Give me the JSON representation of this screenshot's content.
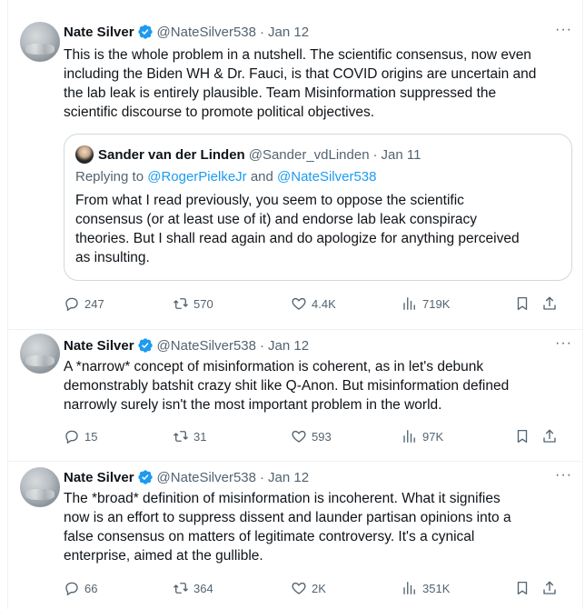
{
  "colors": {
    "text": "#0f1419",
    "secondary": "#536471",
    "link": "#1d9bf0",
    "verified": "#1d9bf0",
    "border": "#cfd9de"
  },
  "tweets": [
    {
      "author": {
        "name": "Nate Silver",
        "handle": "@NateSilver538",
        "verified": true
      },
      "date": "Jan 12",
      "more_label": "···",
      "lines": [
        "This is the whole problem in a nutshell. The scientific consensus, now even",
        "including the Biden WH & Dr. Fauci, is that COVID origins are uncertain and",
        "the lab leak is entirely plausible. Team Misinformation suppressed the",
        "scientific discourse to promote political objectives."
      ],
      "quote": {
        "author": {
          "name": "Sander van der Linden",
          "handle": "@Sander_vdLinden"
        },
        "date": "Jan 11",
        "reply_prefix": "Replying to ",
        "reply_mention_1": "@RogerPielkeJr",
        "reply_and": " and ",
        "reply_mention_2": "@NateSilver538",
        "lines": [
          "From what I read previously, you seem to oppose the scientific",
          "consensus (or at least use of it) and endorse lab leak conspiracy",
          "theories. But I shall read again and do apologize for anything perceived",
          "as insulting."
        ]
      },
      "stats": {
        "replies": "247",
        "retweets": "570",
        "likes": "4.4K",
        "views": "719K"
      }
    },
    {
      "author": {
        "name": "Nate Silver",
        "handle": "@NateSilver538",
        "verified": true
      },
      "date": "Jan 12",
      "more_label": "···",
      "lines": [
        "A *narrow* concept of misinformation is coherent, as in let's debunk",
        "demonstrably batshit crazy shit like Q-Anon. But misinformation defined",
        "narrowly surely isn't the most important problem in the world."
      ],
      "stats": {
        "replies": "15",
        "retweets": "31",
        "likes": "593",
        "views": "97K"
      }
    },
    {
      "author": {
        "name": "Nate Silver",
        "handle": "@NateSilver538",
        "verified": true
      },
      "date": "Jan 12",
      "more_label": "···",
      "lines": [
        "The *broad* definition of misinformation is incoherent.  What it signifies",
        "now is an effort to suppress dissent and launder partisan opinions into a",
        "false consensus on matters of legitimate controversy. It's a cynical",
        "enterprise, aimed at the gullible."
      ],
      "stats": {
        "replies": "66",
        "retweets": "364",
        "likes": "2K",
        "views": "351K"
      }
    }
  ],
  "icons": {
    "reply": "reply-icon",
    "retweet": "retweet-icon",
    "like": "like-icon",
    "views": "views-icon",
    "bookmark": "bookmark-icon",
    "share": "share-icon",
    "verified": "verified-badge-icon",
    "more": "more-icon"
  }
}
